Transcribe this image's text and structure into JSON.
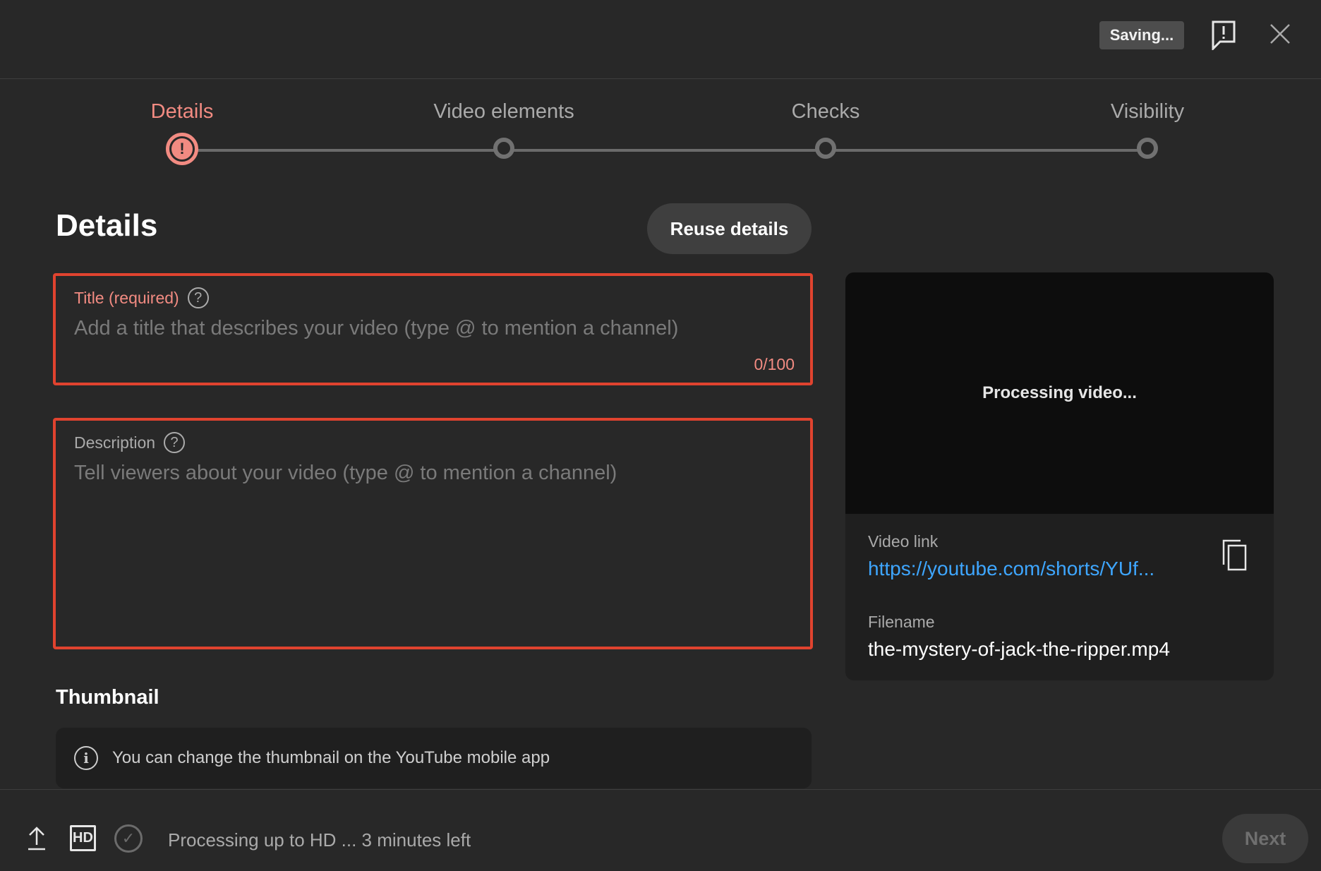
{
  "header": {
    "saving_label": "Saving...",
    "feedback_icon": "feedback-icon",
    "close_icon": "close-icon"
  },
  "stepper": {
    "steps": [
      {
        "label": "Details",
        "state": "error"
      },
      {
        "label": "Video elements",
        "state": "pending"
      },
      {
        "label": "Checks",
        "state": "pending"
      },
      {
        "label": "Visibility",
        "state": "pending"
      }
    ],
    "active_color": "#f28b82"
  },
  "details": {
    "heading": "Details",
    "reuse_label": "Reuse details",
    "title_field": {
      "label": "Title (required)",
      "placeholder": "Add a title that describes your video (type @ to mention a channel)",
      "value": "",
      "count": "0/100"
    },
    "description_field": {
      "label": "Description",
      "placeholder": "Tell viewers about your video (type @ to mention a channel)",
      "value": ""
    },
    "help_glyph": "?",
    "error_border_color": "#e0432f"
  },
  "thumbnail": {
    "heading": "Thumbnail",
    "info_glyph": "i",
    "notice": "You can change the thumbnail on the YouTube mobile app"
  },
  "preview": {
    "status": "Processing video...",
    "video_link_label": "Video link",
    "video_link": "https://youtube.com/shorts/YUf...",
    "filename_label": "Filename",
    "filename": "the-mystery-of-jack-the-ripper.mp4",
    "link_color": "#3ea6ff"
  },
  "footer": {
    "hd_label": "HD",
    "check_glyph": "✓",
    "status": "Processing up to HD ... 3 minutes left",
    "next_label": "Next"
  }
}
